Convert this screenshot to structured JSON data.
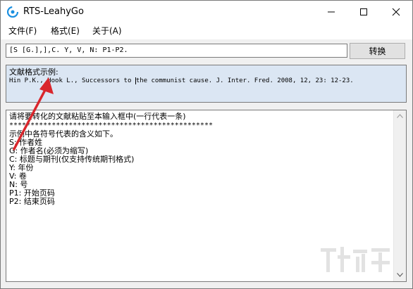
{
  "window": {
    "title": "RTS-LeahyGo",
    "icon": "app-logo-icon",
    "controls": [
      "minimize-icon",
      "maximize-icon",
      "close-icon"
    ]
  },
  "menu": {
    "items": [
      {
        "label": "文件(F)"
      },
      {
        "label": "格式(E)"
      },
      {
        "label": "关于(A)"
      }
    ]
  },
  "toolbar": {
    "format_value": "[S [G.],],C. Y, V, N: P1-P2.",
    "convert_label": "转换"
  },
  "example": {
    "label": "文献格式示例:",
    "text_before_caret": "Hin P.K., Hook L., Successors to ",
    "text_after_caret": "the communist cause. J. Inter. Fred. 2008, 12, 23: 12-23."
  },
  "main": {
    "lines": [
      "请将要转化的文献粘贴至本输入框中(一行代表一条)",
      "************************************************",
      "示例中各符号代表的含义如下。",
      "S: 作者姓",
      "G: 作者名(必须为缩写)",
      "C: 标题与期刊(仅支持传统期刊格式)",
      "Y: 年份",
      "V: 卷",
      "N: 号",
      "P1: 开始页码",
      "P2: 结束页码"
    ]
  },
  "colors": {
    "accent_arrow": "#d9262c",
    "example_bg": "#dbe6f3",
    "logo_blue": "#1a8fe0"
  }
}
